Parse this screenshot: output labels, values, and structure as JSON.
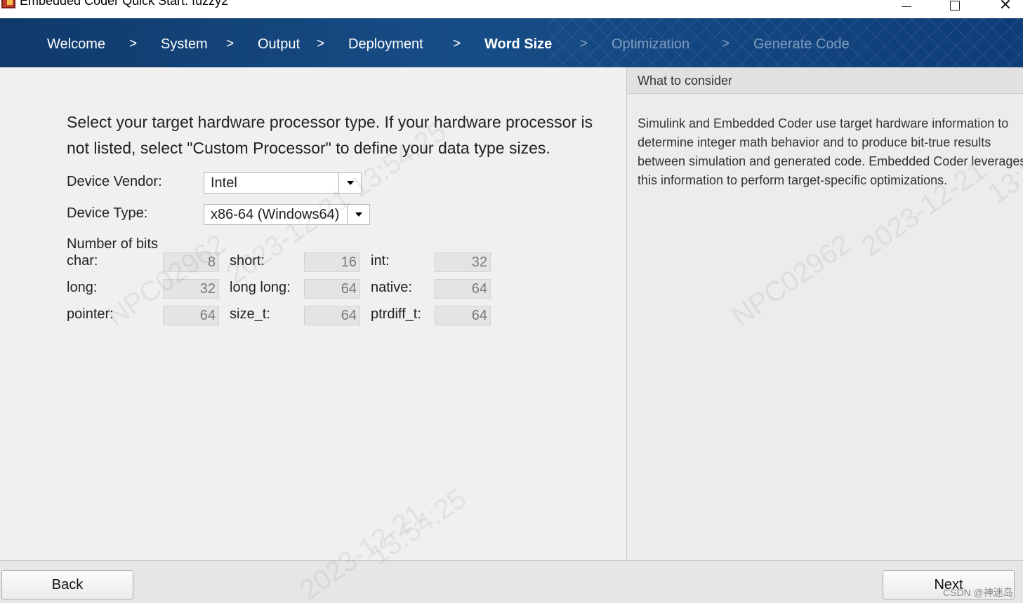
{
  "window": {
    "title": "Embedded Coder Quick Start: fuzzy2",
    "icon": "matlab-app-icon",
    "controls": [
      "minimize-icon",
      "maximize-icon",
      "close-icon"
    ]
  },
  "steps": [
    {
      "label": "Welcome",
      "state": "done"
    },
    {
      "label": "System",
      "state": "done"
    },
    {
      "label": "Output",
      "state": "done"
    },
    {
      "label": "Deployment",
      "state": "done"
    },
    {
      "label": "Word Size",
      "state": "active"
    },
    {
      "label": "Optimization",
      "state": "disabled"
    },
    {
      "label": "Generate Code",
      "state": "disabled"
    }
  ],
  "step_separator": ">",
  "main": {
    "intro": "Select your target hardware processor type. If your hardware processor is not listed, select \"Custom Processor\" to define your data type sizes.",
    "vendor_label": "Device Vendor:",
    "vendor_value": "Intel",
    "type_label": "Device Type:",
    "type_value": "x86-64 (Windows64)",
    "bits_heading": "Number of bits",
    "bits": [
      {
        "label": "char:",
        "value": "8"
      },
      {
        "label": "short:",
        "value": "16"
      },
      {
        "label": "int:",
        "value": "32"
      },
      {
        "label": "long:",
        "value": "32"
      },
      {
        "label": "long long:",
        "value": "64"
      },
      {
        "label": "native:",
        "value": "64"
      },
      {
        "label": "pointer:",
        "value": "64"
      },
      {
        "label": "size_t:",
        "value": "64"
      },
      {
        "label": "ptrdiff_t:",
        "value": "64"
      }
    ]
  },
  "side": {
    "heading": "What to consider",
    "body": "Simulink and Embedded Coder use target hardware information to determine integer math behavior and to produce bit-true results between simulation and generated code. Embedded Coder leverages this information to perform target-specific optimizations."
  },
  "footer": {
    "back_label": "Back",
    "next_label": "Next"
  },
  "watermarks": {
    "id": "NPC02962",
    "datetime": "2023-12-21  13:54:25",
    "date": "2023-12-21",
    "time": "13:54:25",
    "csdn": "CSDN @神迷岛"
  },
  "colors": {
    "banner": "#174d86",
    "step_disabled": "#7f9bbd",
    "panel_bg": "#f0f0f0"
  }
}
